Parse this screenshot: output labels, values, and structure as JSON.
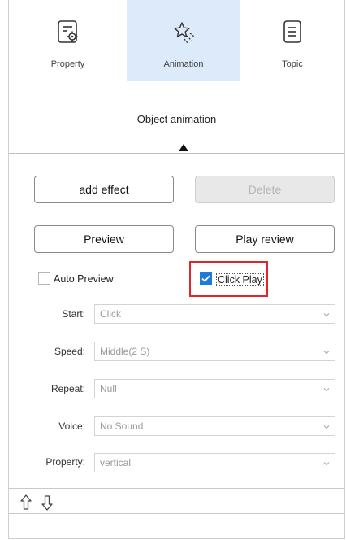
{
  "tabs": [
    {
      "label": "Property",
      "icon": "property-settings-icon"
    },
    {
      "label": "Animation",
      "icon": "animation-star-icon"
    },
    {
      "label": "Topic",
      "icon": "topic-document-icon"
    }
  ],
  "section_title": "Object animation",
  "buttons": {
    "add_effect": "add effect",
    "delete": "Delete",
    "preview": "Preview",
    "play_review": "Play review"
  },
  "checkboxes": {
    "auto_preview": {
      "label": "Auto Preview",
      "checked": false
    },
    "click_play": {
      "label": "Click Play",
      "checked": true
    }
  },
  "fields": [
    {
      "label": "Start:",
      "value": "Click"
    },
    {
      "label": "Speed:",
      "value": "Middle(2 S)"
    },
    {
      "label": "Repeat:",
      "value": "Null"
    },
    {
      "label": "Voice:",
      "value": "No Sound"
    },
    {
      "label": "Property:",
      "value": "vertical"
    }
  ],
  "colors": {
    "active_tab": "#dceaf9",
    "checkbox_blue": "#1f7ad8",
    "highlight_red": "#e0262b"
  }
}
